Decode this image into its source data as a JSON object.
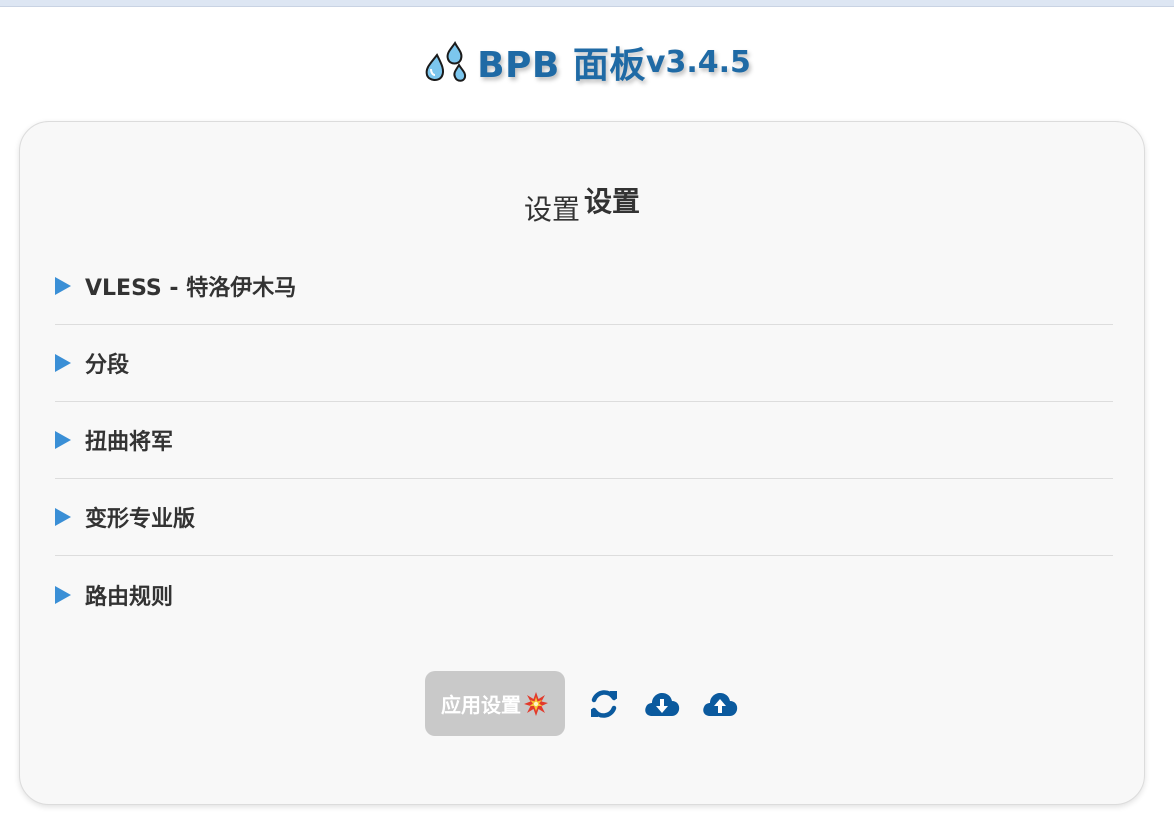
{
  "header": {
    "title": "BPB 面板",
    "version": "v3.4.5",
    "icon": "sweat-droplets-icon",
    "brand_color": "#1f6aa5"
  },
  "settings": {
    "title_light": "设置",
    "title_bold": "设置",
    "sections": [
      {
        "label": "VLESS - 特洛伊木马",
        "icon": "triangle-right-icon"
      },
      {
        "label": "分段",
        "icon": "triangle-right-icon"
      },
      {
        "label": "扭曲将军",
        "icon": "triangle-right-icon"
      },
      {
        "label": "变形专业版",
        "icon": "triangle-right-icon"
      },
      {
        "label": "路由规则",
        "icon": "triangle-right-icon"
      }
    ],
    "arrow_color": "#3a8fd6"
  },
  "actions": {
    "apply_label": "应用设置",
    "apply_icon": "collision-icon",
    "reset_icon": "refresh-icon",
    "download_icon": "cloud-download-icon",
    "upload_icon": "cloud-upload-icon",
    "icon_color": "#0b5a9e",
    "apply_bg": "#c9c9c9"
  }
}
